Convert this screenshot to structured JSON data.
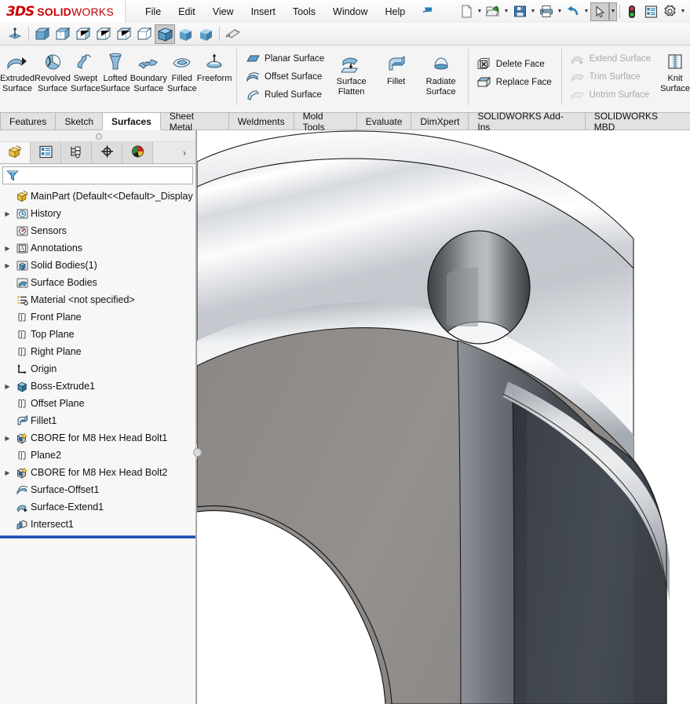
{
  "app": {
    "brand_3ds": "3DS",
    "brand_bold": "SOLID",
    "brand_light": "WORKS",
    "accent_color": "#cc0000",
    "rollback_color": "#1f4fb5"
  },
  "menubar": {
    "items": [
      {
        "label": "File",
        "name": "menu-file"
      },
      {
        "label": "Edit",
        "name": "menu-edit"
      },
      {
        "label": "View",
        "name": "menu-view"
      },
      {
        "label": "Insert",
        "name": "menu-insert"
      },
      {
        "label": "Tools",
        "name": "menu-tools"
      },
      {
        "label": "Window",
        "name": "menu-window"
      },
      {
        "label": "Help",
        "name": "menu-help"
      }
    ],
    "pin_icon": "pin-icon",
    "quick_access": [
      {
        "name": "new-document-icon",
        "caret": true
      },
      {
        "name": "open-document-icon",
        "caret": true
      },
      {
        "name": "save-icon",
        "caret": true
      },
      {
        "name": "print-icon",
        "caret": true
      },
      {
        "name": "undo-icon",
        "caret": true
      },
      {
        "name": "select-cursor-icon",
        "caret": true,
        "selected": true
      },
      {
        "name": "rebuild-stoplight-icon",
        "caret": false
      },
      {
        "name": "display-options-icon",
        "caret": false
      },
      {
        "name": "settings-gear-icon",
        "caret": true
      }
    ]
  },
  "viewbar": {
    "items": [
      {
        "name": "view-orientation-icon",
        "selected": false
      },
      {
        "name": "wireframe-icon",
        "selected": false
      },
      {
        "name": "hidden-lines-visible-icon",
        "selected": false
      },
      {
        "name": "hidden-lines-removed-icon",
        "selected": false
      },
      {
        "name": "shaded-with-edges-wire-icon",
        "selected": false
      },
      {
        "name": "shaded-wireframe-icon",
        "selected": false
      },
      {
        "name": "draft-quality-icon",
        "selected": false
      },
      {
        "name": "shaded-with-edges-icon",
        "selected": true
      },
      {
        "name": "shaded-icon",
        "selected": false
      },
      {
        "name": "perspective-icon",
        "selected": false
      },
      {
        "name": "section-view-icon",
        "selected": false
      }
    ]
  },
  "ribbon": {
    "big_buttons": [
      {
        "label": "Extruded\nSurface",
        "line1": "Extruded",
        "line2": "Surface",
        "name": "extruded-surface-button",
        "icon": "extruded-surface-icon"
      },
      {
        "label": "Revolved Surface",
        "line1": "Revolved",
        "line2": "Surface",
        "name": "revolved-surface-button",
        "icon": "revolved-surface-icon"
      },
      {
        "label": "Swept Surface",
        "line1": "Swept",
        "line2": "Surface",
        "name": "swept-surface-button",
        "icon": "swept-surface-icon"
      },
      {
        "label": "Lofted Surface",
        "line1": "Lofted",
        "line2": "Surface",
        "name": "lofted-surface-button",
        "icon": "lofted-surface-icon"
      },
      {
        "label": "Boundary Surface",
        "line1": "Boundary",
        "line2": "Surface",
        "name": "boundary-surface-button",
        "icon": "boundary-surface-icon"
      },
      {
        "label": "Filled Surface",
        "line1": "Filled",
        "line2": "Surface",
        "name": "filled-surface-button",
        "icon": "filled-surface-icon"
      },
      {
        "label": "Freeform",
        "line1": "Freeform",
        "line2": "",
        "name": "freeform-button",
        "icon": "freeform-icon"
      }
    ],
    "group_planar": [
      {
        "label": "Planar Surface",
        "name": "planar-surface-button",
        "icon": "planar-surface-icon",
        "disabled": false
      },
      {
        "label": "Offset Surface",
        "name": "offset-surface-button",
        "icon": "offset-surface-icon",
        "disabled": false
      },
      {
        "label": "Ruled Surface",
        "name": "ruled-surface-button",
        "icon": "ruled-surface-icon",
        "disabled": false
      }
    ],
    "group_mid": [
      {
        "line1": "Surface",
        "line2": "Flatten",
        "name": "surface-flatten-button",
        "icon": "surface-flatten-icon"
      },
      {
        "line1": "Fillet",
        "line2": "",
        "name": "fillet-button",
        "icon": "surface-fillet-icon"
      },
      {
        "line1": "Radiate",
        "line2": "Surface",
        "name": "radiate-surface-button",
        "icon": "radiate-surface-icon"
      }
    ],
    "group_face": [
      {
        "label": "Delete Face",
        "name": "delete-face-button",
        "icon": "delete-face-icon",
        "disabled": false
      },
      {
        "label": "Replace Face",
        "name": "replace-face-button",
        "icon": "replace-face-icon",
        "disabled": false
      }
    ],
    "group_trim": [
      {
        "label": "Extend Surface",
        "name": "extend-surface-button",
        "icon": "extend-surface-icon",
        "disabled": true
      },
      {
        "label": "Trim Surface",
        "name": "trim-surface-button",
        "icon": "trim-surface-icon",
        "disabled": true
      },
      {
        "label": "Untrim Surface",
        "name": "untrim-surface-button",
        "icon": "untrim-surface-icon",
        "disabled": true
      }
    ],
    "knit": {
      "line1": "Knit",
      "line2": "Surface",
      "name": "knit-surface-button",
      "icon": "knit-surface-icon"
    }
  },
  "command_tabs": [
    {
      "label": "Features",
      "name": "tab-features",
      "active": false
    },
    {
      "label": "Sketch",
      "name": "tab-sketch",
      "active": false
    },
    {
      "label": "Surfaces",
      "name": "tab-surfaces",
      "active": true
    },
    {
      "label": "Sheet Metal",
      "name": "tab-sheet-metal",
      "active": false
    },
    {
      "label": "Weldments",
      "name": "tab-weldments",
      "active": false
    },
    {
      "label": "Mold Tools",
      "name": "tab-mold-tools",
      "active": false
    },
    {
      "label": "Evaluate",
      "name": "tab-evaluate",
      "active": false
    },
    {
      "label": "DimXpert",
      "name": "tab-dimxpert",
      "active": false
    },
    {
      "label": "SOLIDWORKS Add-Ins",
      "name": "tab-solidworks-add-ins",
      "active": false
    },
    {
      "label": "SOLIDWORKS MBD",
      "name": "tab-solidworks-mbd",
      "active": false
    }
  ],
  "feature_manager": {
    "tabs": [
      {
        "name": "feature-tree-tab",
        "icon": "feature-tree-icon",
        "active": true
      },
      {
        "name": "property-manager-tab",
        "icon": "property-manager-icon",
        "active": false
      },
      {
        "name": "configuration-manager-tab",
        "icon": "configuration-manager-icon",
        "active": false
      },
      {
        "name": "dimxpert-manager-tab",
        "icon": "dimxpert-target-icon",
        "active": false
      },
      {
        "name": "display-manager-tab",
        "icon": "display-manager-sphere-icon",
        "active": false
      }
    ],
    "expand_chevron": "›",
    "filter": {
      "placeholder": "",
      "value": "",
      "icon": "filter-funnel-icon"
    },
    "tree": [
      {
        "label": "MainPart  (Default<<Default>_Display Stat",
        "icon": "part-icon",
        "expandable": false,
        "indent": 0,
        "root": true
      },
      {
        "label": "History",
        "icon": "history-icon",
        "expandable": true,
        "indent": 1
      },
      {
        "label": "Sensors",
        "icon": "sensors-icon",
        "expandable": false,
        "indent": 1
      },
      {
        "label": "Annotations",
        "icon": "annotations-icon",
        "expandable": true,
        "indent": 1
      },
      {
        "label": "Solid Bodies(1)",
        "icon": "solid-bodies-icon",
        "expandable": true,
        "indent": 1
      },
      {
        "label": "Surface Bodies",
        "icon": "surface-bodies-icon",
        "expandable": false,
        "indent": 1
      },
      {
        "label": "Material <not specified>",
        "icon": "material-icon",
        "expandable": false,
        "indent": 1
      },
      {
        "label": "Front Plane",
        "icon": "plane-icon",
        "expandable": false,
        "indent": 1
      },
      {
        "label": "Top Plane",
        "icon": "plane-icon",
        "expandable": false,
        "indent": 1
      },
      {
        "label": "Right Plane",
        "icon": "plane-icon",
        "expandable": false,
        "indent": 1
      },
      {
        "label": "Origin",
        "icon": "origin-icon",
        "expandable": false,
        "indent": 1
      },
      {
        "label": "Boss-Extrude1",
        "icon": "boss-extrude-icon",
        "expandable": true,
        "indent": 1
      },
      {
        "label": "Offset Plane",
        "icon": "plane-icon",
        "expandable": false,
        "indent": 1
      },
      {
        "label": "Fillet1",
        "icon": "fillet-icon",
        "expandable": false,
        "indent": 1
      },
      {
        "label": "CBORE for M8 Hex Head Bolt1",
        "icon": "hole-wizard-icon",
        "expandable": true,
        "indent": 1
      },
      {
        "label": "Plane2",
        "icon": "plane-icon",
        "expandable": false,
        "indent": 1
      },
      {
        "label": "CBORE for M8 Hex Head Bolt2",
        "icon": "hole-wizard-icon",
        "expandable": true,
        "indent": 1
      },
      {
        "label": "Surface-Offset1",
        "icon": "surface-offset-icon",
        "expandable": false,
        "indent": 1
      },
      {
        "label": "Surface-Extend1",
        "icon": "surface-extend-icon",
        "expandable": false,
        "indent": 1
      },
      {
        "label": "Intersect1",
        "icon": "intersect-icon",
        "expandable": false,
        "indent": 1
      }
    ]
  },
  "viewport": {
    "name": "graphics-area",
    "background": "#ffffff",
    "model_name": "MainPart",
    "colors": {
      "top_light": "#d5d8dd",
      "top_highlight": "#fafbfc",
      "front_face": "#8f8b89",
      "side_dark": "#3a3f46",
      "hole_inner": "#4a4c4f",
      "edge": "#1a1a1a"
    }
  }
}
